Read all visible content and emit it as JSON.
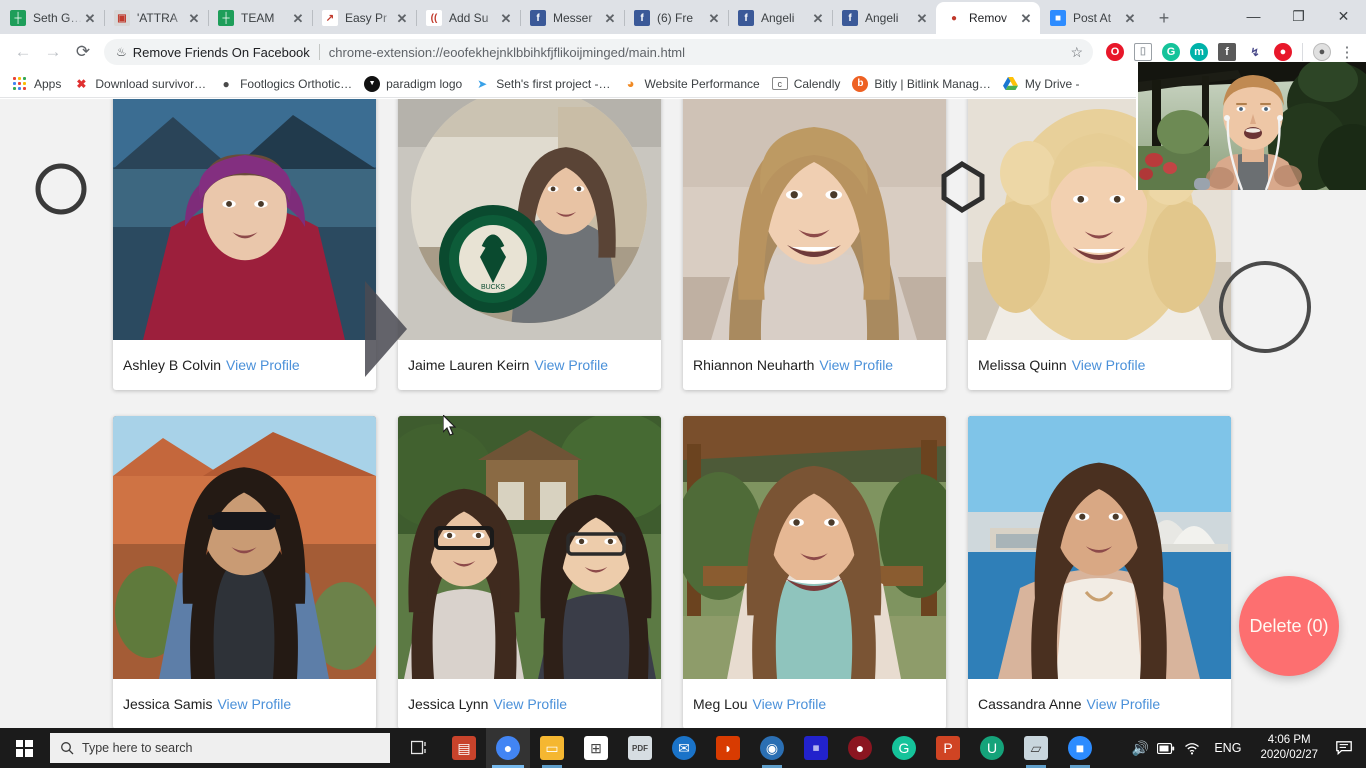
{
  "browser": {
    "tabs": [
      {
        "title": "Seth G…",
        "favicon": "sheets-icon",
        "color": "#1e9e5a",
        "glyph": "┼",
        "active": false
      },
      {
        "title": "'ATTRA",
        "favicon": "image-icon",
        "color": "#d8d8d8",
        "glyph": "▣",
        "active": false
      },
      {
        "title": "TEAM",
        "favicon": "sheets-icon",
        "color": "#1e9e5a",
        "glyph": "┼",
        "active": false
      },
      {
        "title": "Easy Pr",
        "favicon": "chart-icon",
        "color": "#ffffff",
        "glyph": "↗",
        "active": false
      },
      {
        "title": "Add Su",
        "favicon": "brackets-icon",
        "color": "#ffffff",
        "glyph": "((",
        "active": false
      },
      {
        "title": "Messer",
        "favicon": "facebook-icon",
        "color": "#3b5998",
        "glyph": "f",
        "active": false
      },
      {
        "title": "(6) Fre",
        "favicon": "facebook-icon",
        "color": "#3b5998",
        "glyph": "f",
        "active": false
      },
      {
        "title": "Angeli",
        "favicon": "facebook-icon",
        "color": "#3b5998",
        "glyph": "f",
        "active": false
      },
      {
        "title": "Angeli",
        "favicon": "facebook-icon",
        "color": "#3b5998",
        "glyph": "f",
        "active": false
      },
      {
        "title": "Remov",
        "favicon": "remove-friends-icon",
        "color": "#ffffff",
        "glyph": "●",
        "active": true
      },
      {
        "title": "Post At",
        "favicon": "video-icon",
        "color": "#2d8cff",
        "glyph": "■",
        "active": false
      }
    ],
    "new_tab_label": "+",
    "close_label": "✕",
    "window_controls": {
      "minimize": "—",
      "maximize": "❐",
      "close": "✕"
    },
    "nav": {
      "back": "←",
      "forward": "→",
      "reload": "⟳"
    },
    "omnibox": {
      "extension_name": "Remove Friends On Facebook",
      "url": "chrome-extension://eoofekhejnklbbihkfjflikoijminged/main.html",
      "star": "☆",
      "puzzle_icon": "puzzle-piece-icon"
    },
    "extension_icons": [
      {
        "name": "opera-gx-icon",
        "color": "#e8172a",
        "glyph": "O"
      },
      {
        "name": "clipboard-icon",
        "color": "#9aa0a6",
        "glyph": "⌷"
      },
      {
        "name": "grammarly-icon",
        "color": "#15c39a",
        "glyph": "G"
      },
      {
        "name": "mailtrack-icon",
        "color": "#00b2a9",
        "glyph": "m"
      },
      {
        "name": "facebook-pixel-icon",
        "color": "#5a5a5a",
        "glyph": "f"
      },
      {
        "name": "runner-icon",
        "color": "#4a4a8a",
        "glyph": "↯"
      },
      {
        "name": "remove-friends-icon",
        "color": "#e8172a",
        "glyph": "●"
      }
    ],
    "profile_icon": "user-avatar-icon",
    "menu_icon": "three-dot-menu-icon",
    "bookmarks": [
      {
        "label": "Apps",
        "icon": "apps-grid-icon",
        "color": ""
      },
      {
        "label": "Download survivor…",
        "icon": "x-icon",
        "color": "#e03030"
      },
      {
        "label": "Footlogics Orthotic…",
        "icon": "globe-icon",
        "color": "#4a4a4a"
      },
      {
        "label": "paradigm logo",
        "icon": "paradigm-icon",
        "color": "#111111"
      },
      {
        "label": "Seth's first project -…",
        "icon": "flow-icon",
        "color": "#39a1e8"
      },
      {
        "label": "Website Performance",
        "icon": "drop-icon",
        "color": "#f08a24"
      },
      {
        "label": "Calendly",
        "icon": "calendly-icon",
        "color": "#666666"
      },
      {
        "label": "Bitly | Bitlink Manag…",
        "icon": "bitly-icon",
        "color": "#ee6123"
      },
      {
        "label": "My Drive -",
        "icon": "google-drive-icon",
        "color": "#34a853"
      }
    ]
  },
  "page": {
    "cards": [
      {
        "name": "Ashley B Colvin",
        "link": "View Profile",
        "photo": "woman-purple-hood-lake"
      },
      {
        "name": "Jaime Lauren Keirn",
        "link": "View Profile",
        "photo": "woman-circle-bucks-logo"
      },
      {
        "name": "Rhiannon Neuharth",
        "link": "View Profile",
        "photo": "blonde-woman-smiling"
      },
      {
        "name": "Melissa Quinn",
        "link": "View Profile",
        "photo": "blonde-woman-curly-hair"
      },
      {
        "name": "Jessica Samis",
        "link": "View Profile",
        "photo": "woman-sunglasses-desert"
      },
      {
        "name": "Jessica Lynn",
        "link": "View Profile",
        "photo": "two-women-glasses"
      },
      {
        "name": "Meg Lou",
        "link": "View Profile",
        "photo": "woman-tropical-porch"
      },
      {
        "name": "Cassandra Anne",
        "link": "View Profile",
        "photo": "woman-sydney-harbour"
      }
    ],
    "delete_button": {
      "label": "Delete (0)",
      "color": "#fd6f70"
    }
  },
  "annotations": [
    {
      "name": "circle-annotation-left",
      "shape": "circle"
    },
    {
      "name": "diamond-annotation-middle",
      "shape": "diamond"
    },
    {
      "name": "circle-annotation-right",
      "shape": "circle"
    }
  ],
  "webcam": {
    "name": "webcam-overlay",
    "description": "presenter outdoors on porch"
  },
  "taskbar": {
    "start_label": "start-button",
    "search": {
      "placeholder": "Type here to search",
      "icon": "search-icon"
    },
    "task_view": "task-view-icon",
    "apps": [
      {
        "name": "winrar-icon",
        "color": "#c8432b",
        "glyph": "▤"
      },
      {
        "name": "google-chrome-icon",
        "color": "#4285f4",
        "glyph": "●",
        "active": true
      },
      {
        "name": "file-explorer-icon",
        "color": "#f5b731",
        "glyph": "▭",
        "open": true
      },
      {
        "name": "microsoft-store-icon",
        "color": "#ffffff",
        "glyph": "⊞"
      },
      {
        "name": "pdf-reader-icon",
        "color": "#d6dde2",
        "glyph": "PDF"
      },
      {
        "name": "thunderbird-icon",
        "color": "#1a73c8",
        "glyph": "✉"
      },
      {
        "name": "office-icon",
        "color": "#d83b01",
        "glyph": "◗"
      },
      {
        "name": "camtasia-icon",
        "color": "#2b6fb3",
        "glyph": "◉",
        "open": true
      },
      {
        "name": "numerology-icon",
        "color": "#2222cc",
        "glyph": "▦"
      },
      {
        "name": "remove-friends-app-icon",
        "color": "#8b1520",
        "glyph": "●"
      },
      {
        "name": "grammarly-app-icon",
        "color": "#15c39a",
        "glyph": "G"
      },
      {
        "name": "powerpoint-icon",
        "color": "#d04423",
        "glyph": "P"
      },
      {
        "name": "iobit-uninstaller-icon",
        "color": "#15a37a",
        "glyph": "U"
      },
      {
        "name": "notes-icon",
        "color": "#c9d6dd",
        "glyph": "▱",
        "open": true
      },
      {
        "name": "zoom-icon",
        "color": "#2d8cff",
        "glyph": "■",
        "open": true
      }
    ],
    "tray": {
      "volume": "speaker-icon",
      "battery": "battery-icon",
      "wifi": "wifi-icon",
      "language": "ENG",
      "time": "4:06 PM",
      "date": "2020/02/27",
      "notifications": "notification-center-icon"
    }
  }
}
